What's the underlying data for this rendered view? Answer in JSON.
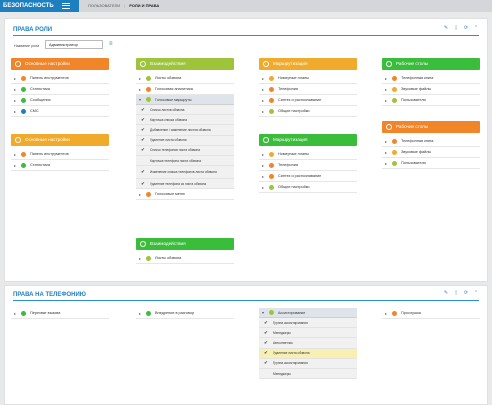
{
  "topbar": {
    "brand": "БЕЗОПАСНОСТЬ",
    "crumb1": "ПОЛЬЗОВАТЕЛИ",
    "crumb2": "РОЛИ И ПРАВА"
  },
  "roles_panel": {
    "title": "ПРАВА РОЛИ",
    "role_label": "Название роли",
    "role_value": "Администратор"
  },
  "c1a": {
    "title": "Основные настройки",
    "items": [
      "Панель инструментов",
      "Статистика",
      "Сообщения",
      "СМС"
    ]
  },
  "c1b": {
    "title": "Основные настройки",
    "items": [
      "Панель инструментов",
      "Статистика"
    ]
  },
  "c2a": {
    "title": "Взаимодействия",
    "items": [
      "Листы обзвона",
      "Голосовая аналитика"
    ],
    "sub_header": "Голосовые маршруты",
    "subs": [
      "Список листов обзвона",
      "Карточка списка обзвона",
      "Добавление / изменение листов обзвона",
      "Удаление листа обзвона",
      "Список телефонов листа обзвона",
      "Карточка телефона листа обзвона",
      "Изменение списка телефонов листа обзвона",
      "Удаление телефона из листа обзвона"
    ],
    "after": "Голосовые меню"
  },
  "c2b": {
    "title": "Взаимодействия",
    "items": [
      "Листы обзвона"
    ]
  },
  "c3a": {
    "title": "Маршрутизация",
    "items": [
      "Номерные планы",
      "Телефония",
      "Синтез и распознавание",
      "Общие настройки"
    ]
  },
  "c3b": {
    "title": "Маршрутизация",
    "items": [
      "Номерные планы",
      "Телефония",
      "Синтез и распознавание",
      "Общие настройки"
    ]
  },
  "c4a": {
    "title": "Рабочие столы",
    "items": [
      "Телефонная книга",
      "Звуковые файлы",
      "Пользователи"
    ]
  },
  "c4b": {
    "title": "Рабочие столы",
    "items": [
      "Телефонная книга",
      "Звуковые файлы",
      "Пользователи"
    ]
  },
  "tel_panel": {
    "title": "ПРАВА НА ТЕЛЕФОНИЮ",
    "c1": "Перехват вызова",
    "c2": "Внедрение в разговор",
    "c3_header": "Ассистирование",
    "c3_subs": [
      "Группа ассистирования",
      "Менеджеры",
      "Автоответчик",
      "Удаление листа обзвона",
      "Группа ассистирования",
      "Менеджеры"
    ],
    "c4": "Прослушка"
  },
  "colors": {
    "brand": "#1e7fc0",
    "orange": "#f0852a",
    "yellow": "#f0ab2c",
    "green": "#3bbd3c",
    "lime": "#9dc43a"
  }
}
